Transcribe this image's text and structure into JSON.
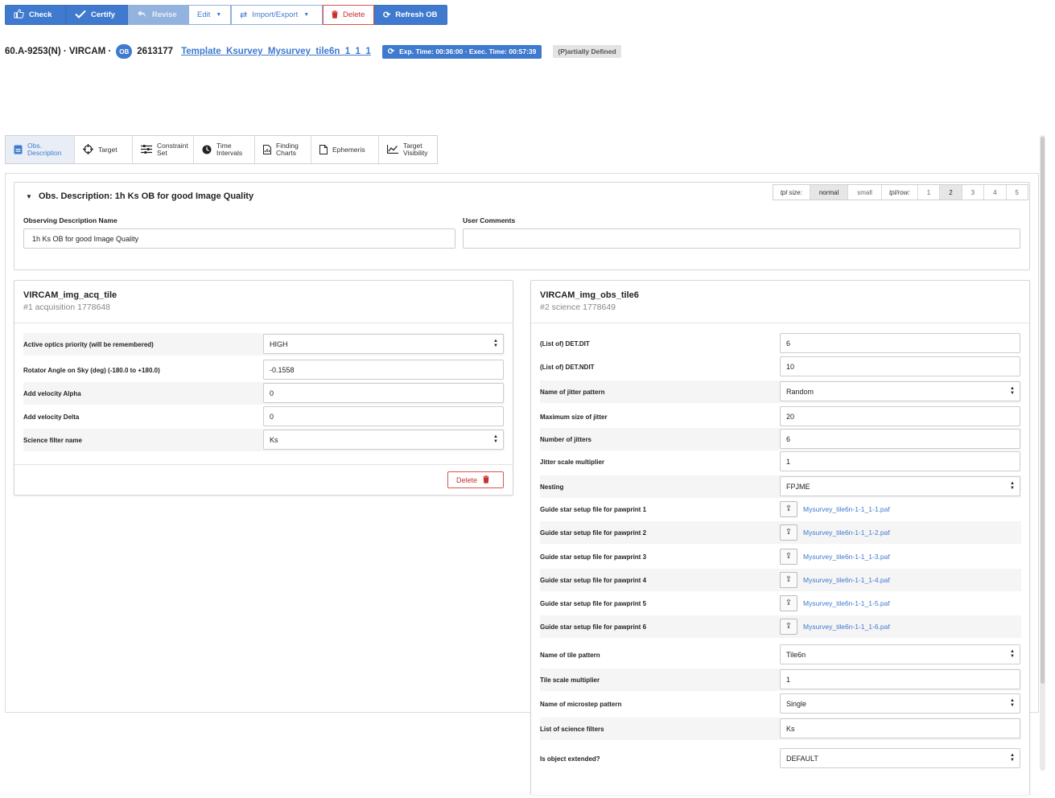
{
  "toolbar": {
    "check": "Check",
    "certify": "Certify",
    "revise": "Revise",
    "edit": "Edit",
    "import_export": "Import/Export",
    "delete": "Delete",
    "refresh": "Refresh OB"
  },
  "header": {
    "run_id": "60.A-9253(N) · VIRCAM ·",
    "ob_badge": "OB",
    "ob_id": "2613177",
    "template_link": "Template_Ksurvey_Mysurvey_tile6n_1_1_1",
    "time_info": "Exp. Time: 00:36:00 · Exec. Time: 00:57:39",
    "status": "(P)artially Defined"
  },
  "tabs": [
    {
      "label": "Obs. Description"
    },
    {
      "label": "Target"
    },
    {
      "label": "Constraint Set"
    },
    {
      "label": "Time Intervals"
    },
    {
      "label": "Finding Charts"
    },
    {
      "label": "Ephemeris"
    },
    {
      "label": "Target Visibility"
    }
  ],
  "obs_desc": {
    "title": "Obs. Description: 1h Ks OB for good Image Quality",
    "name_label": "Observing Description Name",
    "name_value": "1h Ks OB for good Image Quality",
    "comments_label": "User Comments",
    "comments_value": ""
  },
  "size_controls": {
    "tpl_size_label": "tpl size:",
    "normal": "normal",
    "small": "small",
    "tpl_row_label": "tpl/row:",
    "n1": "1",
    "n2": "2",
    "n3": "3",
    "n4": "4",
    "n5": "5"
  },
  "acq_template": {
    "name": "VIRCAM_img_acq_tile",
    "subtitle": "#1 acquisition 1778648",
    "params": [
      {
        "label": "Active optics priority (will be remembered)",
        "value": "HIGH"
      },
      {
        "label": "Rotator Angle on Sky (deg) (-180.0 to +180.0)",
        "value": "-0.1558"
      },
      {
        "label": "Add velocity Alpha",
        "value": "0"
      },
      {
        "label": "Add velocity Delta",
        "value": "0"
      },
      {
        "label": "Science filter name",
        "value": "Ks"
      }
    ],
    "delete_label": "Delete"
  },
  "obs_template": {
    "name": "VIRCAM_img_obs_tile6",
    "subtitle": "#2 science 1778649",
    "params": [
      {
        "label": "(List of) DET.DIT",
        "value": "6"
      },
      {
        "label": "(List of) DET.NDIT",
        "value": "10"
      },
      {
        "label": "Name of jitter pattern",
        "value": "Random"
      },
      {
        "label": "Maximum size of jitter",
        "value": "20"
      },
      {
        "label": "Number of jitters",
        "value": "6"
      },
      {
        "label": "Jitter scale multiplier",
        "value": "1"
      },
      {
        "label": "Nesting",
        "value": "FPJME"
      },
      {
        "label": "Guide star setup file for pawprint 1",
        "value": "Mysurvey_tile6n-1-1_1-1.paf"
      },
      {
        "label": "Guide star setup file for pawprint 2",
        "value": "Mysurvey_tile6n-1-1_1-2.paf"
      },
      {
        "label": "Guide star setup file for pawprint 3",
        "value": "Mysurvey_tile6n-1-1_1-3.paf"
      },
      {
        "label": "Guide star setup file for pawprint 4",
        "value": "Mysurvey_tile6n-1-1_1-4.paf"
      },
      {
        "label": "Guide star setup file for pawprint 5",
        "value": "Mysurvey_tile6n-1-1_1-5.paf"
      },
      {
        "label": "Guide star setup file for pawprint 6",
        "value": "Mysurvey_tile6n-1-1_1-6.paf"
      },
      {
        "label": "Name of tile pattern",
        "value": "Tile6n"
      },
      {
        "label": "Tile scale multiplier",
        "value": "1"
      },
      {
        "label": "Name of microstep pattern",
        "value": "Single"
      },
      {
        "label": "List of science filters",
        "value": "Ks"
      },
      {
        "label": "Is object extended?",
        "value": "DEFAULT"
      }
    ]
  },
  "colors": {
    "accent": "#3f7acf",
    "danger": "#c9302c",
    "status_bg": "#e3e3e3"
  }
}
